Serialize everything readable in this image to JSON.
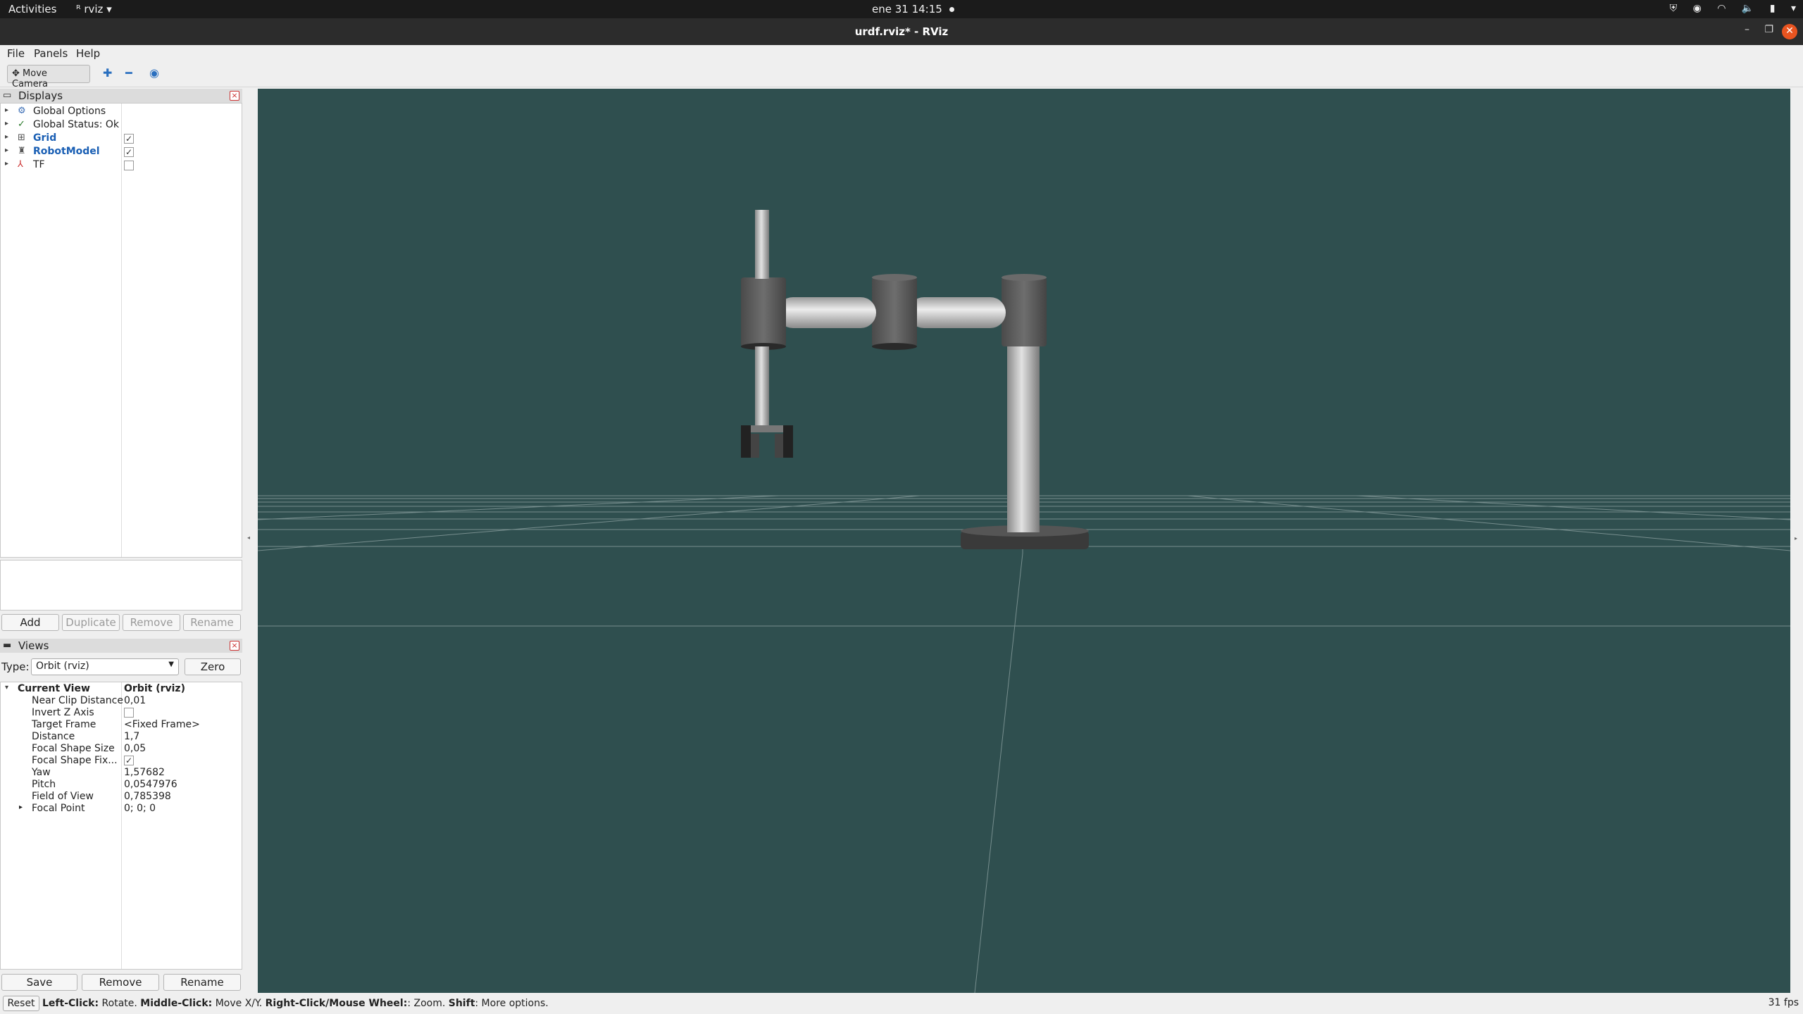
{
  "topbar": {
    "activities": "Activities",
    "app": "rviz ▾",
    "app_icon": "rviz-icon",
    "clock": "ene 31  14:15"
  },
  "window": {
    "title": "urdf.rviz* - RViz"
  },
  "menu": {
    "file": "File",
    "panels": "Panels",
    "help": "Help"
  },
  "toolbar": {
    "move_camera": "Move Camera",
    "icons": [
      "interact-plus-icon",
      "minus-icon",
      "focus-camera-icon"
    ]
  },
  "displays": {
    "title": "Displays",
    "items": [
      {
        "label": "Global Options",
        "icon": "gear-icon",
        "checked": null
      },
      {
        "label": "Global Status: Ok",
        "icon": "check-icon",
        "checked": null
      },
      {
        "label": "Grid",
        "icon": "grid-icon",
        "checked": true
      },
      {
        "label": "RobotModel",
        "icon": "robot-icon",
        "checked": true
      },
      {
        "label": "TF",
        "icon": "tf-axes-icon",
        "checked": false
      }
    ],
    "buttons": {
      "add": "Add",
      "duplicate": "Duplicate",
      "remove": "Remove",
      "rename": "Rename"
    }
  },
  "views": {
    "title": "Views",
    "type_label": "Type:",
    "type_value": "Orbit (rviz)",
    "zero": "Zero",
    "current_view_label": "Current View",
    "current_view_value": "Orbit (rviz)",
    "props": [
      {
        "label": "Near Clip Distance",
        "value": "0,01"
      },
      {
        "label": "Invert Z Axis",
        "value": ""
      },
      {
        "label": "Target Frame",
        "value": "<Fixed Frame>"
      },
      {
        "label": "Distance",
        "value": "1,7"
      },
      {
        "label": "Focal Shape Size",
        "value": "0,05"
      },
      {
        "label": "Focal Shape Fix...",
        "value": "✓"
      },
      {
        "label": "Yaw",
        "value": "1,57682"
      },
      {
        "label": "Pitch",
        "value": "0,0547976"
      },
      {
        "label": "Field of View",
        "value": "0,785398"
      },
      {
        "label": "Focal Point",
        "value": "0; 0; 0"
      }
    ],
    "buttons": {
      "save": "Save",
      "remove": "Remove",
      "rename": "Rename"
    }
  },
  "statusbar": {
    "reset": "Reset",
    "hint_left_click_b": "Left-Click:",
    "hint_left_click": " Rotate. ",
    "hint_middle_b": "Middle-Click:",
    "hint_middle": " Move X/Y. ",
    "hint_right_b": "Right-Click/Mouse Wheel:",
    "hint_right": ": Zoom. ",
    "hint_shift_b": "Shift",
    "hint_shift": ": More options.",
    "fps": "31 fps"
  },
  "colors": {
    "viewport_bg": "#2f4f4f",
    "accent": "#1a5fb4",
    "close": "#e95420"
  }
}
